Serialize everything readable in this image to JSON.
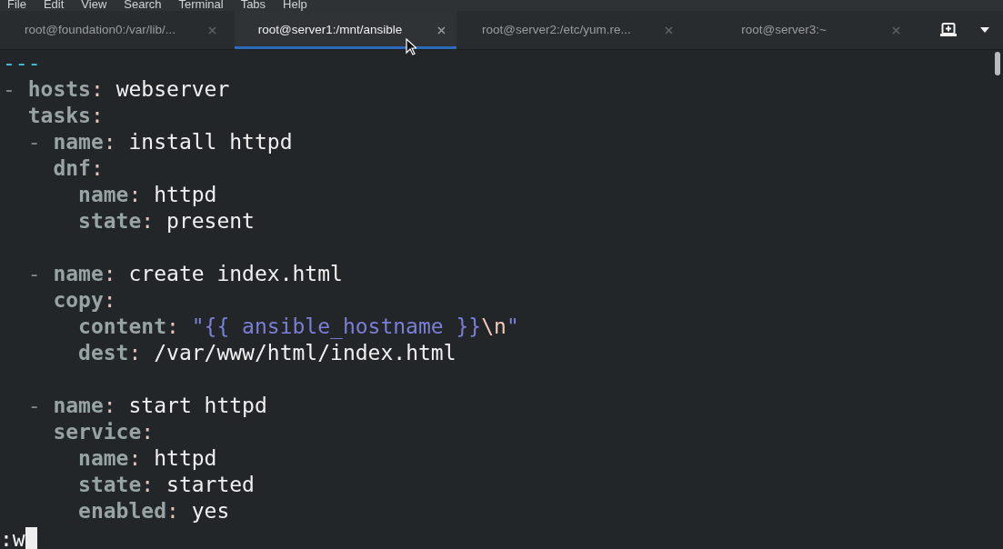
{
  "menu": [
    "File",
    "Edit",
    "View",
    "Search",
    "Terminal",
    "Tabs",
    "Help"
  ],
  "tabs": [
    {
      "label": "root@foundation0:/var/lib/...",
      "selected": false
    },
    {
      "label": "root@server1:/mnt/ansible",
      "selected": true
    },
    {
      "label": "root@server2:/etc/yum.re...",
      "selected": false
    },
    {
      "label": "root@server3:~",
      "selected": false
    }
  ],
  "editor": {
    "lines": [
      {
        "kind": "code",
        "segments": [
          {
            "kind": "marker",
            "text": "---"
          }
        ]
      },
      {
        "kind": "code",
        "segments": [
          {
            "kind": "dash",
            "text": "- "
          },
          {
            "kind": "key",
            "text": "hosts"
          },
          {
            "kind": "colon",
            "text": ":"
          },
          {
            "kind": "value",
            "text": " webserver"
          }
        ]
      },
      {
        "kind": "code",
        "segments": [
          {
            "kind": "key",
            "text": "  tasks"
          },
          {
            "kind": "colon",
            "text": ":"
          }
        ]
      },
      {
        "kind": "code",
        "segments": [
          {
            "kind": "dash",
            "text": "  - "
          },
          {
            "kind": "key",
            "text": "name"
          },
          {
            "kind": "colon",
            "text": ":"
          },
          {
            "kind": "value",
            "text": " install httpd"
          }
        ]
      },
      {
        "kind": "code",
        "segments": [
          {
            "kind": "key",
            "text": "    dnf"
          },
          {
            "kind": "colon",
            "text": ":"
          }
        ]
      },
      {
        "kind": "code",
        "segments": [
          {
            "kind": "key",
            "text": "      name"
          },
          {
            "kind": "colon",
            "text": ":"
          },
          {
            "kind": "value",
            "text": " httpd"
          }
        ]
      },
      {
        "kind": "code",
        "segments": [
          {
            "kind": "key",
            "text": "      state"
          },
          {
            "kind": "colon",
            "text": ":"
          },
          {
            "kind": "value",
            "text": " present"
          }
        ]
      },
      {
        "kind": "blank"
      },
      {
        "kind": "code",
        "segments": [
          {
            "kind": "dash",
            "text": "  - "
          },
          {
            "kind": "key",
            "text": "name"
          },
          {
            "kind": "colon",
            "text": ":"
          },
          {
            "kind": "value",
            "text": " create index.html"
          }
        ]
      },
      {
        "kind": "code",
        "segments": [
          {
            "kind": "key",
            "text": "    copy"
          },
          {
            "kind": "colon",
            "text": ":"
          }
        ]
      },
      {
        "kind": "code",
        "segments": [
          {
            "kind": "key",
            "text": "      content"
          },
          {
            "kind": "colon",
            "text": ":"
          },
          {
            "kind": "string",
            "text": " \"{{ ansible_hostname }}"
          },
          {
            "kind": "escape",
            "text": "\\n"
          },
          {
            "kind": "string",
            "text": "\""
          }
        ]
      },
      {
        "kind": "code",
        "segments": [
          {
            "kind": "key",
            "text": "      dest"
          },
          {
            "kind": "colon",
            "text": ":"
          },
          {
            "kind": "value",
            "text": " /var/www/html/index.html"
          }
        ]
      },
      {
        "kind": "blank"
      },
      {
        "kind": "code",
        "segments": [
          {
            "kind": "dash",
            "text": "  - "
          },
          {
            "kind": "key",
            "text": "name"
          },
          {
            "kind": "colon",
            "text": ":"
          },
          {
            "kind": "value",
            "text": " start httpd"
          }
        ]
      },
      {
        "kind": "code",
        "segments": [
          {
            "kind": "key",
            "text": "    service"
          },
          {
            "kind": "colon",
            "text": ":"
          }
        ]
      },
      {
        "kind": "code",
        "segments": [
          {
            "kind": "key",
            "text": "      name"
          },
          {
            "kind": "colon",
            "text": ":"
          },
          {
            "kind": "value",
            "text": " httpd"
          }
        ]
      },
      {
        "kind": "code",
        "segments": [
          {
            "kind": "key",
            "text": "      state"
          },
          {
            "kind": "colon",
            "text": ":"
          },
          {
            "kind": "value",
            "text": " started"
          }
        ]
      },
      {
        "kind": "code",
        "segments": [
          {
            "kind": "key",
            "text": "      enabled"
          },
          {
            "kind": "colon",
            "text": ":"
          },
          {
            "kind": "value",
            "text": " yes"
          }
        ]
      }
    ],
    "command": ":w"
  }
}
